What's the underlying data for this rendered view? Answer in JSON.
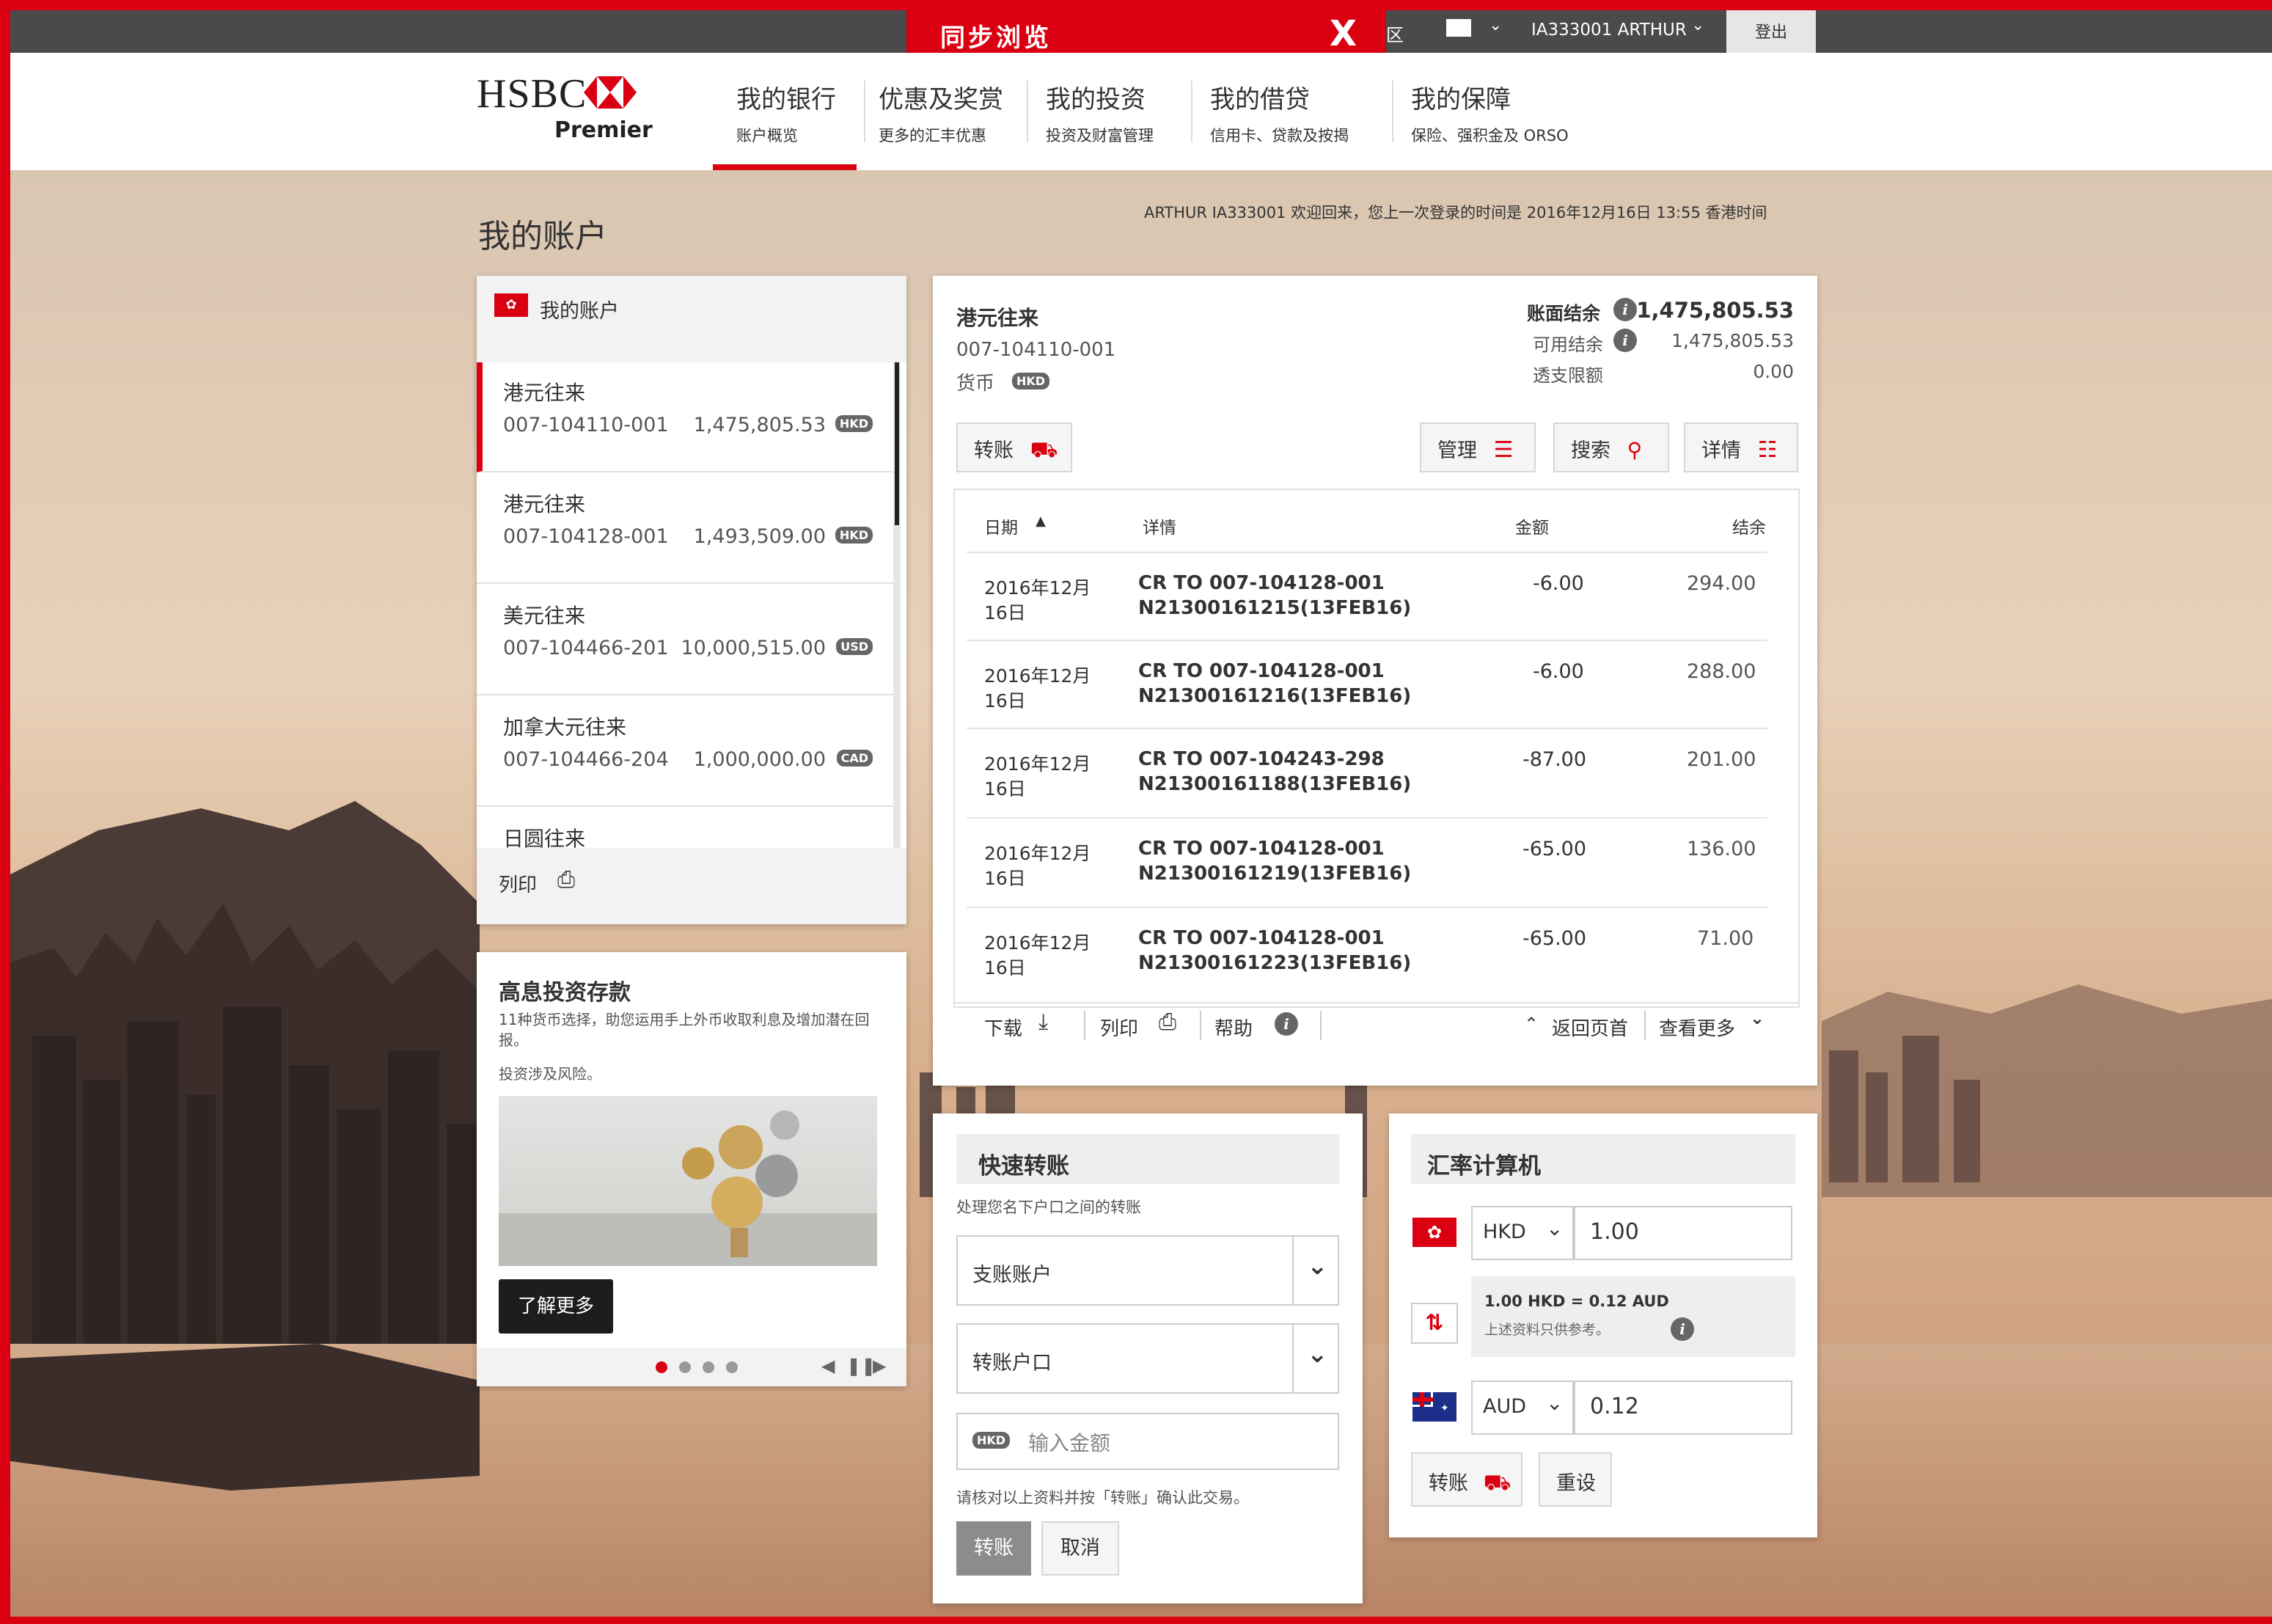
{
  "cobrowse": {
    "title": "同步浏览",
    "close": "X"
  },
  "topbar": {
    "region": "区",
    "user": "IA333001 ARTHUR",
    "logout": "登出"
  },
  "brand": {
    "name": "HSBC",
    "tier": "Premier"
  },
  "nav": [
    {
      "label": "我的银行",
      "sub": "账户概览"
    },
    {
      "label": "优惠及奖赏",
      "sub": "更多的汇丰优惠"
    },
    {
      "label": "我的投资",
      "sub": "投资及财富管理"
    },
    {
      "label": "我的借贷",
      "sub": "信用卡、贷款及按揭"
    },
    {
      "label": "我的保障",
      "sub": "保险、强积金及 ORSO"
    }
  ],
  "page": {
    "title": "我的账户",
    "welcome": "ARTHUR IA333001 欢迎回来，您上一次登录的时间是 2016年12月16日 13:55 香港时间"
  },
  "accounts": {
    "header": "我的账户",
    "items": [
      {
        "name": "港元往来",
        "number": "007-104110-001",
        "balance": "1,475,805.53",
        "currency": "HKD"
      },
      {
        "name": "港元往来",
        "number": "007-104128-001",
        "balance": "1,493,509.00",
        "currency": "HKD"
      },
      {
        "name": "美元往来",
        "number": "007-104466-201",
        "balance": "10,000,515.00",
        "currency": "USD"
      },
      {
        "name": "加拿大元往来",
        "number": "007-104466-204",
        "balance": "1,000,000.00",
        "currency": "CAD"
      },
      {
        "name": "日圆往来"
      }
    ],
    "print": "列印"
  },
  "promo": {
    "title": "高息投资存款",
    "desc": "11种货币选择，助您运用手上外币收取利息及增加潜在回报。",
    "risk": "投资涉及风险。",
    "cta": "了解更多"
  },
  "detail": {
    "name": "港元往来",
    "number": "007-104110-001",
    "currency_label": "货币",
    "currency": "HKD",
    "ledger_label": "账面结余",
    "ledger": "1,475,805.53",
    "available_label": "可用结余",
    "available": "1,475,805.53",
    "overdraft_label": "透支限额",
    "overdraft": "0.00",
    "transfer": "转账",
    "manage": "管理",
    "search": "搜索",
    "details": "详情",
    "columns": [
      "日期",
      "详情",
      "金额",
      "结余"
    ],
    "transactions": [
      {
        "date1": "2016年12月",
        "date2": "16日",
        "desc1": "CR TO 007-104128-001",
        "desc2": "N21300161215(13FEB16)",
        "amount": "-6.00",
        "balance": "294.00"
      },
      {
        "date1": "2016年12月",
        "date2": "16日",
        "desc1": "CR TO 007-104128-001",
        "desc2": "N21300161216(13FEB16)",
        "amount": "-6.00",
        "balance": "288.00"
      },
      {
        "date1": "2016年12月",
        "date2": "16日",
        "desc1": "CR TO 007-104243-298",
        "desc2": "N21300161188(13FEB16)",
        "amount": "-87.00",
        "balance": "201.00"
      },
      {
        "date1": "2016年12月",
        "date2": "16日",
        "desc1": "CR TO 007-104128-001",
        "desc2": "N21300161219(13FEB16)",
        "amount": "-65.00",
        "balance": "136.00"
      },
      {
        "date1": "2016年12月",
        "date2": "16日",
        "desc1": "CR TO 007-104128-001",
        "desc2": "N21300161223(13FEB16)",
        "amount": "-65.00",
        "balance": "71.00"
      }
    ],
    "download": "下载",
    "print": "列印",
    "help": "帮助",
    "back_top": "返回页首",
    "more": "查看更多"
  },
  "quick_transfer": {
    "title": "快速转账",
    "subtitle": "处理您名下户口之间的转账",
    "from_placeholder": "支账账户",
    "to_placeholder": "转账户口",
    "currency": "HKD",
    "amount_placeholder": "输入金额",
    "note": "请核对以上资料并按「转账」确认此交易。",
    "submit": "转账",
    "cancel": "取消"
  },
  "fx": {
    "title": "汇率计算机",
    "from_ccy": "HKD",
    "from_amount": "1.00",
    "rate": "1.00 HKD = 0.12 AUD",
    "rate_note": "上述资料只供参考。",
    "to_ccy": "AUD",
    "to_amount": "0.12",
    "transfer": "转账",
    "reset": "重设"
  },
  "colors": {
    "brand_red": "#db0011",
    "topbar": "#4a4a4a",
    "badge": "#666666"
  }
}
